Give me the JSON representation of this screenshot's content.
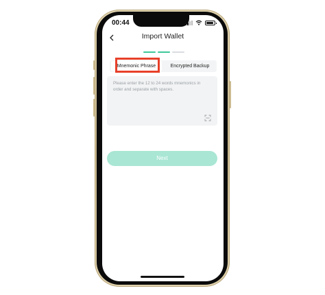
{
  "status": {
    "time": "00:44"
  },
  "header": {
    "title": "Import Wallet",
    "back_icon": "chevron-left-icon"
  },
  "progress": {
    "steps": 3,
    "current": 2,
    "colors": {
      "done": "#3ec79a",
      "pending": "#d9dcdf"
    }
  },
  "tabs": [
    {
      "label": "Mnemonic Phrase",
      "active": true
    },
    {
      "label": "Encrypted Backup",
      "active": false
    }
  ],
  "mnemonic_input": {
    "placeholder": "Please enter the 12 to 24 words mnemonics in order and separate with spaces.",
    "value": "",
    "scan_icon": "scan-icon"
  },
  "next_button": {
    "label": "Next",
    "enabled": false
  },
  "colors": {
    "accent": "#3ec79a",
    "button_disabled": "#a9e6d4",
    "highlight": "#e8402a"
  }
}
